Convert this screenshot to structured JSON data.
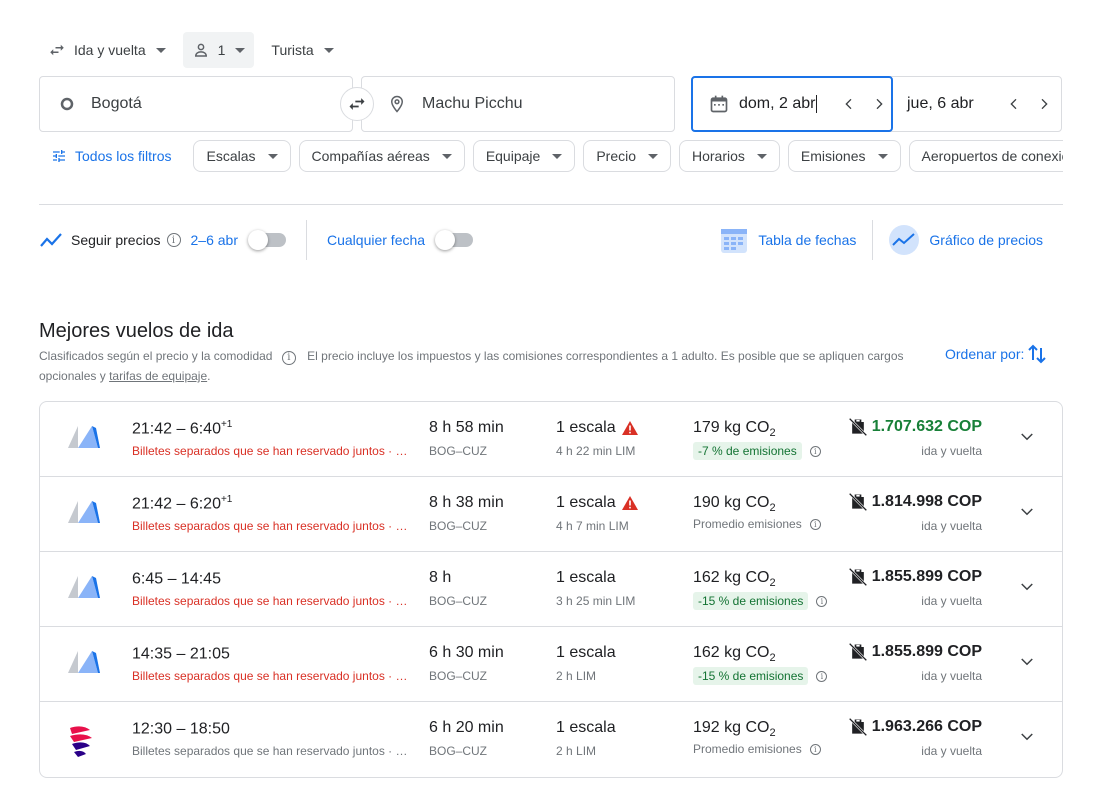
{
  "search": {
    "trip_type": "Ida y vuelta",
    "passengers": "1",
    "cabin": "Turista",
    "origin": "Bogotá",
    "destination": "Machu Picchu",
    "depart_date": "dom, 2 abr",
    "return_date": "jue, 6 abr"
  },
  "filters": {
    "all_label": "Todos los filtros",
    "chips": [
      "Escalas",
      "Compañías aéreas",
      "Equipaje",
      "Precio",
      "Horarios",
      "Emisiones",
      "Aeropuertos de conexión"
    ]
  },
  "tracking": {
    "label": "Seguir precios",
    "range": "2–6 abr",
    "any_date": "Cualquier fecha",
    "date_grid": "Tabla de fechas",
    "price_graph": "Gráfico de precios"
  },
  "results": {
    "title": "Mejores vuelos de ida",
    "subtitle_a": "Clasificados según el precio y la comodidad",
    "subtitle_b": "El precio incluye los impuestos y las comisiones correspondientes a 1 adulto. Es posible que se apliquen cargos opcionales y",
    "subtitle_link": "tarifas de equipaje",
    "subtitle_end": ".",
    "sort_label": "Ordenar por:",
    "flights": [
      {
        "time": "21:42 – 6:40",
        "plus": "+1",
        "note": "Billetes separados que se han reservado juntos · LATAM, Avianca",
        "duration": "8 h 58 min",
        "route": "BOG–CUZ",
        "stops": "1 escala",
        "warn": true,
        "stop_detail": "4 h 22 min LIM",
        "co2": "179 kg CO",
        "emissions": "-7 % de emisiones",
        "em_badge": true,
        "price": "1.707.632 COP",
        "price_green": true,
        "price_note": "ida y vuelta",
        "logo": "wing",
        "note_red": true
      },
      {
        "time": "21:42 – 6:20",
        "plus": "+1",
        "note": "Billetes separados que se han reservado juntos · LATAM, Avianca",
        "duration": "8 h 38 min",
        "route": "BOG–CUZ",
        "stops": "1 escala",
        "warn": true,
        "stop_detail": "4 h 7 min LIM",
        "co2": "190 kg CO",
        "emissions": "Promedio emisiones",
        "em_badge": false,
        "price": "1.814.998 COP",
        "price_green": false,
        "price_note": "ida y vuelta",
        "logo": "wing",
        "note_red": true
      },
      {
        "time": "6:45 – 14:45",
        "plus": "",
        "note": "Billetes separados que se han reservado juntos · LATAM, Avianca",
        "duration": "8 h",
        "route": "BOG–CUZ",
        "stops": "1 escala",
        "warn": false,
        "stop_detail": "3 h 25 min LIM",
        "co2": "162 kg CO",
        "emissions": "-15 % de emisiones",
        "em_badge": true,
        "price": "1.855.899 COP",
        "price_green": false,
        "price_note": "ida y vuelta",
        "logo": "wing",
        "note_red": true
      },
      {
        "time": "14:35 – 21:05",
        "plus": "",
        "note": "Billetes separados que se han reservado juntos · LATAM, Avianca",
        "duration": "6 h 30 min",
        "route": "BOG–CUZ",
        "stops": "1 escala",
        "warn": false,
        "stop_detail": "2 h LIM",
        "co2": "162 kg CO",
        "emissions": "-15 % de emisiones",
        "em_badge": true,
        "price": "1.855.899 COP",
        "price_green": false,
        "price_note": "ida y vuelta",
        "logo": "wing",
        "note_red": true
      },
      {
        "time": "12:30 – 18:50",
        "plus": "",
        "note": "Billetes separados que se han reservado juntos · LATAM",
        "duration": "6 h 20 min",
        "route": "BOG–CUZ",
        "stops": "1 escala",
        "warn": false,
        "stop_detail": "2 h LIM",
        "co2": "192 kg CO",
        "emissions": "Promedio emisiones",
        "em_badge": false,
        "price": "1.963.266 COP",
        "price_green": false,
        "price_note": "ida y vuelta",
        "logo": "latam",
        "note_red": false
      }
    ]
  },
  "colors": {
    "accent": "#1a73e8",
    "warning": "#d93025",
    "green": "#188038",
    "badge_bg": "#e6f4ea"
  },
  "icons": [
    "swap-arrows-icon",
    "person-icon",
    "caret-down-icon",
    "circle-icon",
    "location-pin-icon",
    "calendar-icon",
    "chevron-left-icon",
    "chevron-right-icon",
    "tune-icon",
    "trend-icon",
    "info-icon",
    "date-grid-icon",
    "price-graph-icon",
    "sort-icon",
    "warning-icon",
    "no-bag-icon",
    "chevron-down-icon",
    "airline-logo"
  ]
}
